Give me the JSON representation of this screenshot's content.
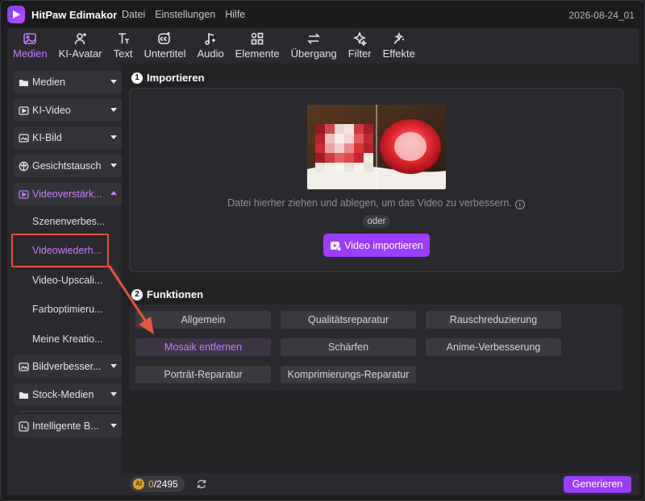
{
  "titlebar": {
    "app_name": "HitPaw Edimakor",
    "menu": [
      "Datei",
      "Einstellungen",
      "Hilfe"
    ],
    "project_name": "2026-08-24_01"
  },
  "toolbar": {
    "items": [
      {
        "label": "Medien",
        "icon": "media-icon",
        "active": true
      },
      {
        "label": "KI-Avatar",
        "icon": "avatar-icon"
      },
      {
        "label": "Text",
        "icon": "text-icon"
      },
      {
        "label": "Untertitel",
        "icon": "subtitle-icon"
      },
      {
        "label": "Audio",
        "icon": "audio-icon"
      },
      {
        "label": "Elemente",
        "icon": "elements-icon"
      },
      {
        "label": "Übergang",
        "icon": "transition-icon"
      },
      {
        "label": "Filter",
        "icon": "filter-icon"
      },
      {
        "label": "Effekte",
        "icon": "effects-icon"
      }
    ],
    "accent": "#c67bff"
  },
  "sidebar": {
    "items": [
      {
        "label": "Medien",
        "icon": "folder-icon"
      },
      {
        "label": "KI-Video",
        "icon": "ai-video-icon"
      },
      {
        "label": "KI-Bild",
        "icon": "ai-image-icon"
      },
      {
        "label": "Gesichtstausch",
        "icon": "face-swap-icon"
      },
      {
        "label": "Videoverstärk...",
        "icon": "video-enhance-icon",
        "expanded": true
      },
      {
        "label": "Bildverbesser...",
        "icon": "image-enhance-icon"
      },
      {
        "label": "Stock-Medien",
        "icon": "stock-media-icon"
      },
      {
        "label": "Intelligente B...",
        "icon": "smart-cutout-icon"
      }
    ],
    "sub_items": [
      {
        "label": "Szenenverbes..."
      },
      {
        "label": "Videowiederh...",
        "active": true
      },
      {
        "label": "Video-Upscali..."
      },
      {
        "label": "Farboptimieru..."
      },
      {
        "label": "Meine Kreatio..."
      }
    ]
  },
  "import": {
    "step": "1",
    "title": "Importieren",
    "drop_text": "Datei hierher ziehen und ablegen, um das Video zu verbessern.",
    "info_glyph": "i",
    "or_label": "oder",
    "button_label": "Video importieren"
  },
  "functions": {
    "step": "2",
    "title": "Funktionen",
    "buttons": [
      {
        "label": "Allgemein"
      },
      {
        "label": "Qualitätsreparatur"
      },
      {
        "label": "Rauschreduzierung"
      },
      {
        "label": "Mosaik entfernen",
        "active": true
      },
      {
        "label": "Schärfen"
      },
      {
        "label": "Anime-Verbesserung"
      },
      {
        "label": "Porträt-Reparatur"
      },
      {
        "label": "Komprimierungs-Reparatur"
      }
    ]
  },
  "bottom": {
    "credits_used": "0",
    "credits_total": "/2495",
    "coin_label": "AI",
    "generate_label": "Generieren"
  },
  "colors": {
    "accent": "#9a3dff",
    "highlight": "#e8543c"
  }
}
